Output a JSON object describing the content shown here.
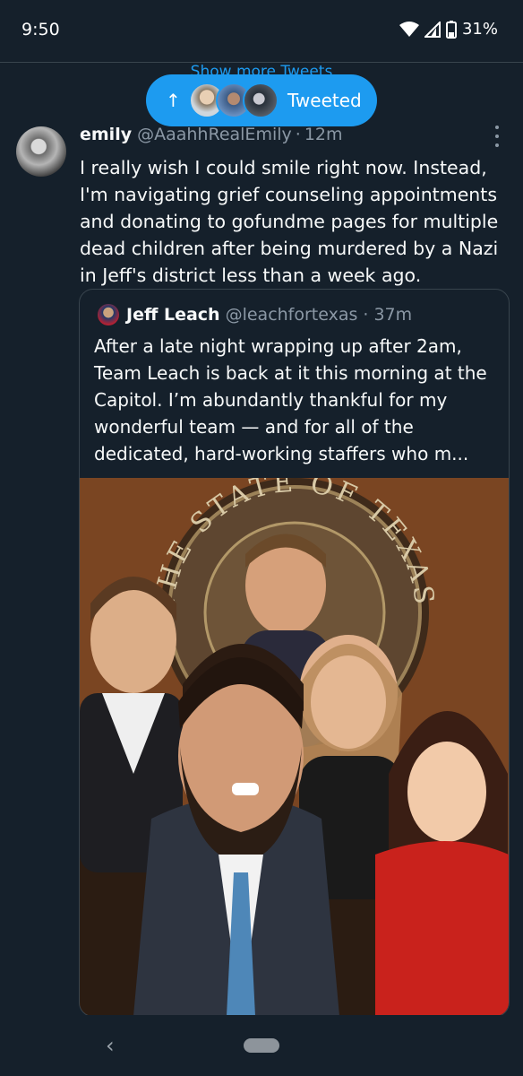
{
  "status_bar": {
    "time": "9:50",
    "battery": "31%"
  },
  "banner": {
    "show_more": "Show more Tweets",
    "pill_label": "Tweeted",
    "arrow": "↑"
  },
  "tweet": {
    "name": "emily",
    "handle": "@AaahhRealEmily",
    "separator": "·",
    "time": "12m",
    "text": "I really wish I could smile right now. Instead, I'm navigating grief counseling appointments and donating to gofundme pages for multiple dead children after being murdered by a Nazi in Jeff's district less than a week ago."
  },
  "quote": {
    "name": "Jeff Leach",
    "handle": "@leachfortexas",
    "separator": "·",
    "time": "37m",
    "text": "After a late night wrapping up after 2am, Team Leach is back at it this morning at the Capitol. I’m abundantly thankful for my wonderful team — and for all of the dedicated, hard-working staffers who m...",
    "photo": {
      "seal_text": "THE STATE OF TEXAS"
    }
  },
  "nav": {
    "back": "‹"
  },
  "colors": {
    "background": "#15202b",
    "accent": "#1d9bf0",
    "muted": "#8b98a5",
    "border": "#38444d"
  }
}
